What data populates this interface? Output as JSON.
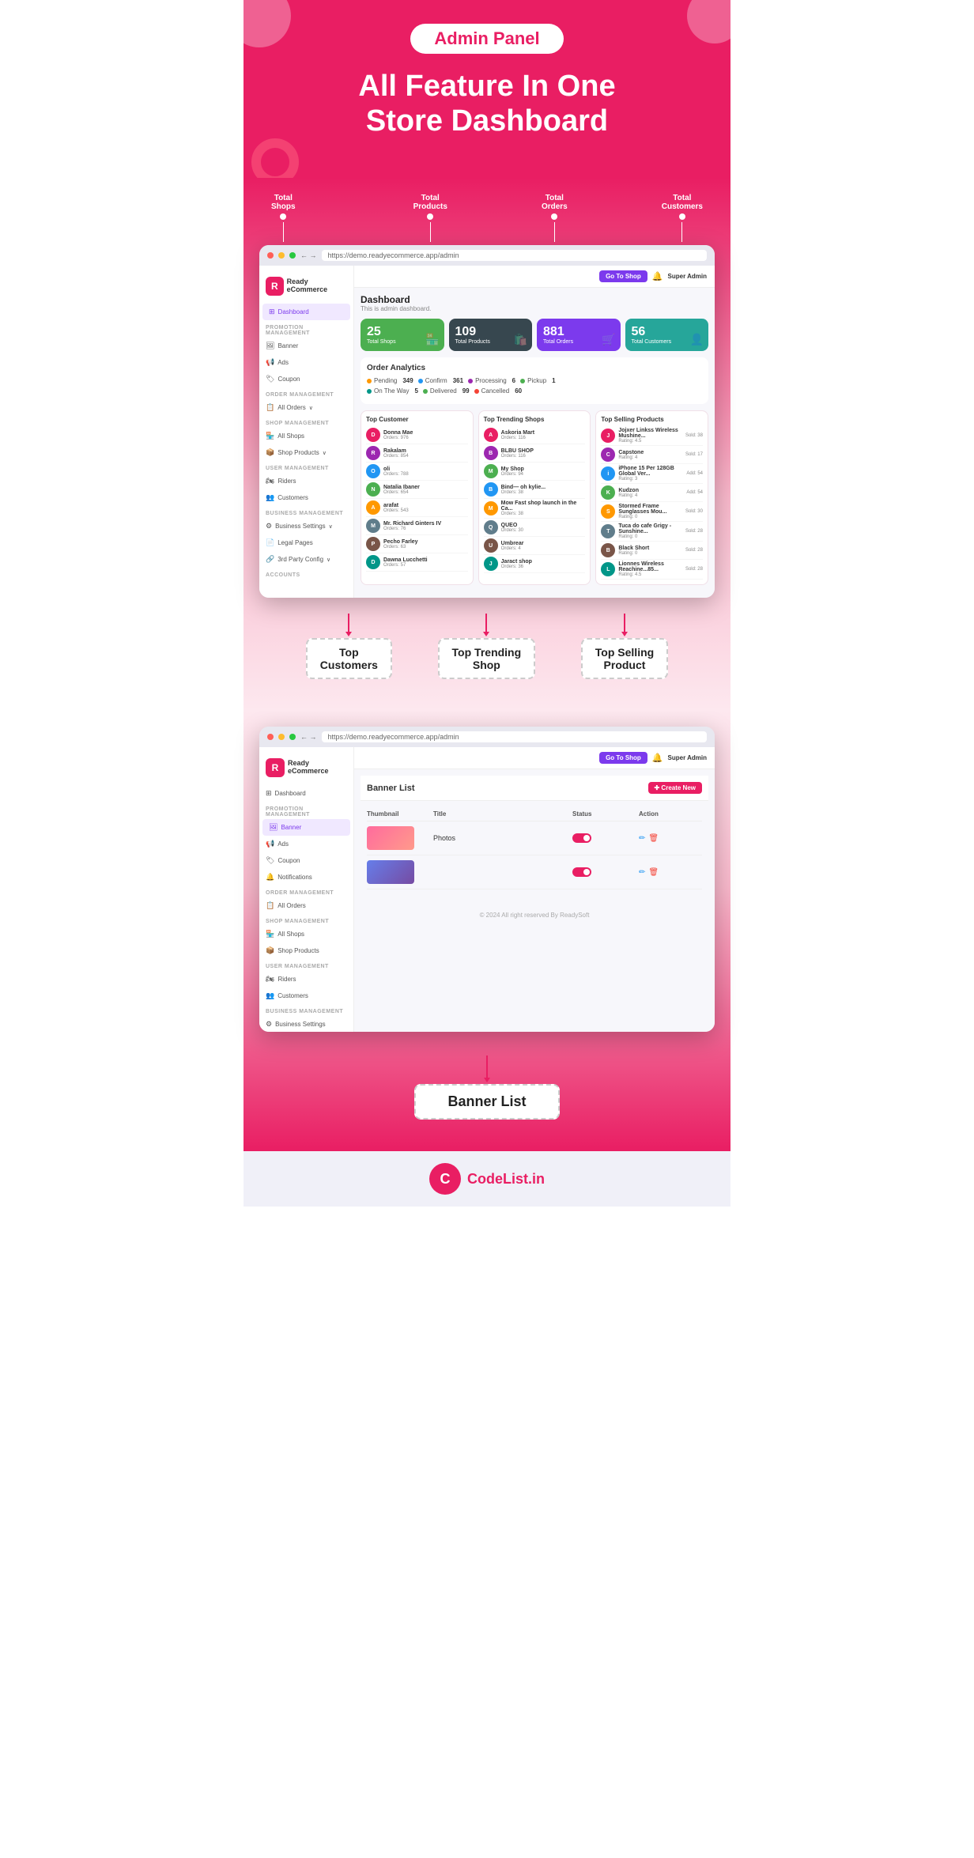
{
  "hero": {
    "badge": "Admin Panel",
    "headline_line1": "All Feature In One",
    "headline_line2": "Store Dashboard"
  },
  "annotations": {
    "top": [
      {
        "id": "total-shops-ann",
        "label": "Total\nShops"
      },
      {
        "id": "total-products-ann",
        "label": "Total\nProducts"
      },
      {
        "id": "total-orders-ann",
        "label": "Total\nOrders"
      },
      {
        "id": "total-customers-ann",
        "label": "Total\nCustomers"
      }
    ],
    "bottom": [
      {
        "id": "top-customers-ann",
        "label": "Top Customers"
      },
      {
        "id": "top-trending-ann",
        "label": "Top Trending Shop"
      },
      {
        "id": "top-selling-ann",
        "label": "Top Selling Product"
      }
    ]
  },
  "browser": {
    "url": "https://demo.readyecommerce.app/admin",
    "go_btn": "Go To Shop",
    "user": "Super Admin"
  },
  "sidebar": {
    "logo_letter": "R",
    "logo_name": "Ready\neCommerce",
    "active_item": "Dashboard",
    "sections": [
      {
        "label": "PROMOTION MANAGEMENT",
        "items": [
          "Banner",
          "Ads",
          "Coupon"
        ]
      },
      {
        "label": "ORDER MANAGEMENT",
        "items": [
          "All Orders"
        ]
      },
      {
        "label": "SHOP MANAGEMENT",
        "items": [
          "All Shops",
          "Shop Products"
        ]
      },
      {
        "label": "USER MANAGEMENT",
        "items": [
          "Riders",
          "Customers"
        ]
      },
      {
        "label": "BUSINESS MANAGEMENT",
        "items": [
          "Business Settings",
          "Legal Pages",
          "3rd Party Config"
        ]
      },
      {
        "label": "ACCOUNTS",
        "items": []
      }
    ]
  },
  "dashboard": {
    "title": "Dashboard",
    "subtitle": "This is admin dashboard.",
    "stats": [
      {
        "id": "total-shops",
        "number": "25",
        "label": "Total Shops",
        "color": "green",
        "icon": "🏪"
      },
      {
        "id": "total-products",
        "number": "109",
        "label": "Total Products",
        "color": "dark",
        "icon": "🛍️"
      },
      {
        "id": "total-orders",
        "number": "881",
        "label": "Total Orders",
        "color": "purple",
        "icon": "🛒"
      },
      {
        "id": "total-customers",
        "number": "56",
        "label": "Total Customers",
        "color": "teal",
        "icon": "👤"
      }
    ],
    "analytics": {
      "title": "Order Analytics",
      "items": [
        {
          "label": "Pending",
          "count": "349",
          "dot": "orange"
        },
        {
          "label": "Confirm",
          "count": "361",
          "dot": "blue"
        },
        {
          "label": "Processing",
          "count": "6",
          "dot": "purple"
        },
        {
          "label": "Pickup",
          "count": "1",
          "dot": "green"
        },
        {
          "label": "On The Way",
          "count": "5",
          "dot": "teal"
        },
        {
          "label": "Delivered",
          "count": "99",
          "dot": "green"
        },
        {
          "label": "Cancelled",
          "count": "60",
          "dot": "red"
        }
      ]
    },
    "top_customers": {
      "title": "Top Customer",
      "items": [
        {
          "name": "Donna Mae",
          "sub": "Orders: 976",
          "color": "#e91e63"
        },
        {
          "name": "Rakalam",
          "sub": "Orders: 854",
          "color": "#9c27b0"
        },
        {
          "name": "oli",
          "sub": "Orders: 788",
          "color": "#2196f3"
        },
        {
          "name": "Natalia Ibaner",
          "sub": "Orders: 654",
          "color": "#4caf50"
        },
        {
          "name": "arafat",
          "sub": "Orders: 543",
          "color": "#ff9800"
        },
        {
          "name": "Mr. Richard Ginters IV",
          "sub": "Orders: 76",
          "color": "#607d8b"
        },
        {
          "name": "Pecho Farley",
          "sub": "Orders: 63",
          "color": "#795548"
        },
        {
          "name": "Dawna Lucchetti",
          "sub": "Orders: 57",
          "color": "#009688"
        }
      ]
    },
    "top_shops": {
      "title": "Top Trending Shops",
      "items": [
        {
          "name": "Askoria Mart",
          "sub": "Orders: 116",
          "color": "#e91e63"
        },
        {
          "name": "BLBU SHOP",
          "sub": "Orders: 116",
          "color": "#9c27b0"
        },
        {
          "name": "My Shop",
          "sub": "Orders: 94",
          "color": "#4caf50"
        },
        {
          "name": "Bind— oh kylie...",
          "sub": "Orders: 38",
          "color": "#2196f3"
        },
        {
          "name": "Mow Fast shop launch in the Ca...",
          "sub": "Orders: 38",
          "color": "#ff9800"
        },
        {
          "name": "QUEO",
          "sub": "Orders: 30",
          "color": "#607d8b"
        },
        {
          "name": "Umbrear",
          "sub": "Orders: 4",
          "color": "#795548"
        },
        {
          "name": "Jaract shop",
          "sub": "Orders: 36",
          "color": "#009688"
        }
      ]
    },
    "top_products": {
      "title": "Top Selling Products",
      "items": [
        {
          "name": "Jojxer Linkss Wireless Mushine...",
          "sub": "Rating: 4.5",
          "badge": "Sold: 38",
          "color": "#e91e63"
        },
        {
          "name": "Capstone",
          "sub": "Rating: 4",
          "badge": "Sold: 17",
          "color": "#9c27b0"
        },
        {
          "name": "iPhone 15 Per 128GB Global Ver...",
          "sub": "Rating: 3",
          "badge": "Add: 54",
          "color": "#2196f3"
        },
        {
          "name": "Kudzon",
          "sub": "Rating: 4",
          "badge": "Add: 54",
          "color": "#4caf50"
        },
        {
          "name": "Stormed Frame Sunglasses Mou...",
          "sub": "Rating: 0",
          "badge": "Sold: 30",
          "color": "#ff9800"
        },
        {
          "name": "Tuca do cafe Grigy - Sunshine...",
          "sub": "Rating: 0",
          "badge": "Sold: 28",
          "color": "#607d8b"
        },
        {
          "name": "Black Short",
          "sub": "Rating: 0",
          "badge": "Sold: 28",
          "color": "#795548"
        },
        {
          "name": "Lionnes Wireless Reachine...85...",
          "sub": "Rating: 4.5",
          "badge": "Sold: 28",
          "color": "#009688"
        }
      ]
    }
  },
  "bottom_annotations": [
    {
      "id": "top-customers-label",
      "label": "Top\nCustomers"
    },
    {
      "id": "top-trending-label",
      "label": "Top Trending\nShop"
    },
    {
      "id": "top-selling-label",
      "label": "Top Selling\nProduct"
    }
  ],
  "banner_section": {
    "page_title": "Banner List",
    "create_btn": "✚ Create New",
    "table_headers": [
      "Thumbnail",
      "Title",
      "Status",
      "Action"
    ],
    "rows": [
      {
        "title": "Photos",
        "status": "active"
      },
      {
        "title": "",
        "status": "active"
      }
    ],
    "bottom_label": "Banner List"
  },
  "footer": {
    "logo": "CodeList.in",
    "sub": "© 2024 All right reserved By ReadySoft"
  }
}
